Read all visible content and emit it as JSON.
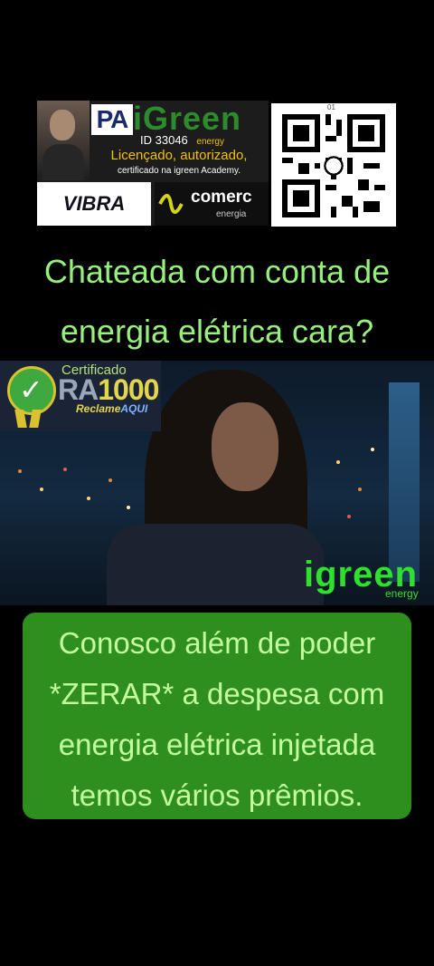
{
  "banner": {
    "pa": "PA",
    "brand": "iGreen",
    "id_label": "ID",
    "id_number": "33046",
    "energy": "energy",
    "licensed": "Licençado, autorizado,",
    "certified": "certificado na igreen Academy.",
    "partner1": "VIBRA",
    "partner2": "comerc",
    "partner2_sub": "energia"
  },
  "qr": {
    "number": "01"
  },
  "headline": {
    "line1": "Chateada com conta de",
    "line2": "energia elétrica cara?"
  },
  "badge": {
    "certificado": "Certificado",
    "ra_prefix": "RA",
    "ra_number": "1000",
    "reclame": "Reclame",
    "aqui": "AQUI"
  },
  "video_logo": {
    "brand": "igreen",
    "sub": "energy"
  },
  "message": {
    "line1": "Conosco além de poder",
    "line2": "*ZERAR* a despesa com",
    "line3": "energia elétrica injetada",
    "line4": "temos vários prêmios."
  },
  "colors": {
    "headline": "#98f07c",
    "box": "#2f8f1d",
    "box_text": "#c3ff9a",
    "logo": "#2fe02f"
  }
}
